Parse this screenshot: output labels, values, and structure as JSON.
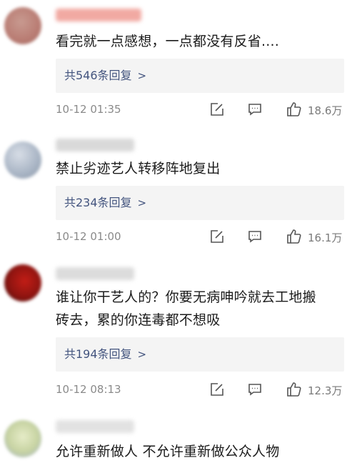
{
  "comments": [
    {
      "text": "看完就一点感想，一点都没有反省....",
      "replies_label": "共546条回复",
      "timestamp": "10-12 01:35",
      "likes": "18.6万",
      "avatar_color": "#b97c73",
      "name_color": "#f1a9a2"
    },
    {
      "text": "禁止劣迹艺人转移阵地复出",
      "replies_label": "共234条回复",
      "timestamp": "10-12 01:00",
      "likes": "16.1万",
      "avatar_color": "#a8b4c4",
      "name_color": "#d9d9d9"
    },
    {
      "text_lines": [
        "谁让你干艺人的？你要无病呻吟就去工地搬",
        "砖去，累的你连毒都不想吸"
      ],
      "replies_label": "共194条回复",
      "timestamp": "10-12 08:13",
      "likes": "12.3万",
      "avatar_color": "#8e1410",
      "name_color": "#dcdcdc"
    },
    {
      "text": "允许重新做人 不允许重新做公众人物",
      "avatar_color": "#c7d3a2",
      "name_color": "#e2e2e2"
    }
  ]
}
